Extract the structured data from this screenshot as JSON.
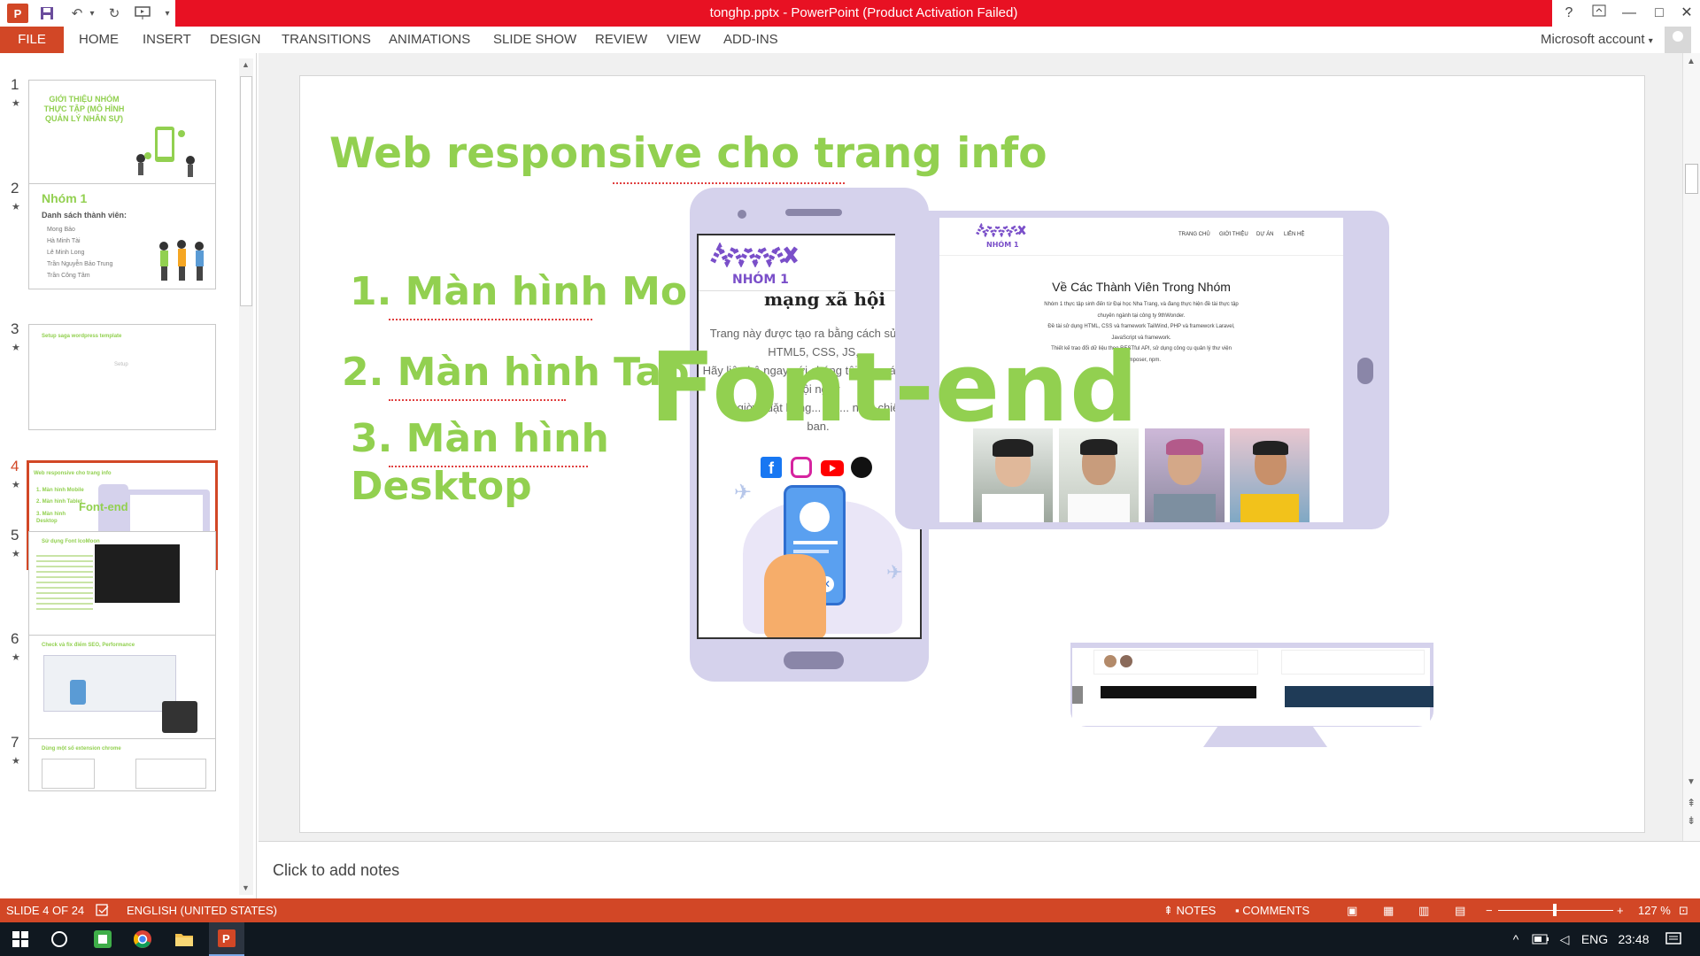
{
  "window": {
    "title": "tonghp.pptx - PowerPoint (Product Activation Failed)",
    "help": "?",
    "controls": [
      "—",
      "□",
      "✕"
    ]
  },
  "ribbon": {
    "file": "FILE",
    "tabs": [
      "HOME",
      "INSERT",
      "DESIGN",
      "TRANSITIONS",
      "ANIMATIONS",
      "SLIDE SHOW",
      "REVIEW",
      "VIEW",
      "ADD-INS"
    ],
    "account": "Microsoft account"
  },
  "thumbnails": [
    {
      "num": "1",
      "title": "GIỚI THIỆU NHÓM THỰC TẬP (MÔ HÌNH QUẢN LÝ NHÂN SỰ)"
    },
    {
      "num": "2",
      "title": "Nhóm 1",
      "subtitle": "Danh sách thành viên:",
      "members": [
        "Mong Bảo",
        "Hà Minh Tài",
        "Lê Minh Long",
        "Trần Nguyễn Bảo Trung",
        "Trần Công Tâm"
      ]
    },
    {
      "num": "3",
      "title": "Setup saga wordpress template",
      "body": "Setup"
    },
    {
      "num": "4",
      "title": "Web responsive cho trang info",
      "items": [
        "1. Màn hình Mobile",
        "2. Màn hình Tablet",
        "3. Màn hình Desktop"
      ],
      "overlay": "Font-end"
    },
    {
      "num": "5",
      "title": "Sử dụng Font IcoMoon"
    },
    {
      "num": "6",
      "title": "Check và fix điểm SEO, Performance"
    },
    {
      "num": "7",
      "title": "Dùng một số extension chrome"
    }
  ],
  "slide": {
    "title": "Web responsive cho trang info",
    "item1": "1. Màn hình Mobile",
    "item2": "2. Màn hình Tablet",
    "item3a": "3. Màn hình",
    "item3b": "Desktop",
    "overlay": "Font-end",
    "mobile": {
      "brand": "NHÓM 1",
      "heading": "mạng xã hội",
      "lines": [
        "Trang này được tạo ra bằng cách sử dụng",
        "HTML5, CSS, JS,...",
        "Hãy liên hệ ngay với chúng tôi trên các mạng",
        "hội ngay",
        "giờ... đặt hàng... tác... ng... chiế",
        "ban."
      ]
    },
    "tablet": {
      "brand": "NHÓM 1",
      "nav": [
        "TRANG CHỦ",
        "GIỚI THIỆU",
        "DỰ ÁN",
        "LIÊN HỆ"
      ],
      "heading": "Về Các Thành Viên Trong Nhóm",
      "lines": [
        "Nhóm 1 thực tập sinh đến từ Đại học Nha Trang, và đang thực hiện đề tài thực tập",
        "chuyên ngành tại công ty 9thWonder.",
        "Đề tài sử dụng HTML, CSS và framework TailWind, PHP và framework Laravel,",
        "JavaScript và framework.",
        "Thiết kế trao đổi dữ liệu theo RESTful API, sử dụng công cụ quản lý thư viện",
        "Composer, npm."
      ]
    }
  },
  "notes": {
    "placeholder": "Click to add notes"
  },
  "status": {
    "slide": "SLIDE 4 OF 24",
    "language": "ENGLISH (UNITED STATES)",
    "notes": "NOTES",
    "comments": "COMMENTS",
    "zoom": "127 %"
  },
  "taskbar": {
    "lang": "ENG",
    "time": "23:48"
  },
  "colors": {
    "accent": "#d24726",
    "green": "#92d050",
    "device": "#d5d2ec",
    "titlebar_red": "#e81123"
  }
}
